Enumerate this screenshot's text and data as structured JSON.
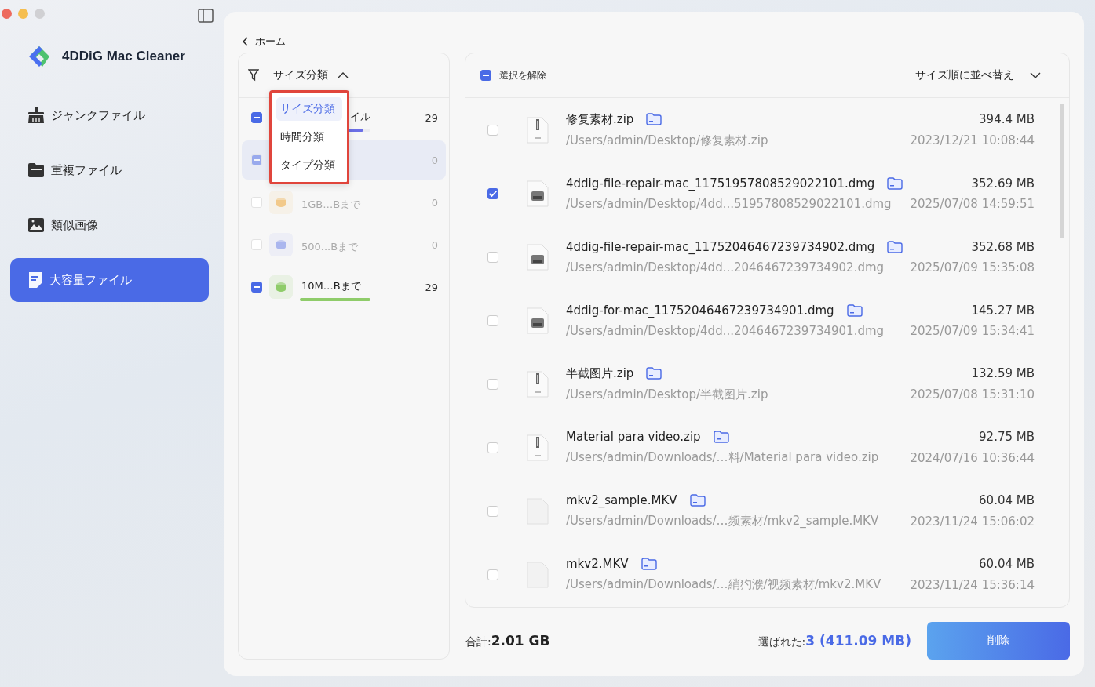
{
  "app": {
    "name": "4DDiG Mac Cleaner"
  },
  "sidebar": {
    "items": [
      {
        "label": "ジャンクファイル",
        "kind": "broom",
        "selected": false
      },
      {
        "label": "重複ファイル",
        "kind": "folder",
        "selected": false
      },
      {
        "label": "類似画像",
        "kind": "image",
        "selected": false
      },
      {
        "label": "大容量ファイル",
        "kind": "note",
        "selected": true
      }
    ]
  },
  "back": {
    "label": "ホーム"
  },
  "filter": {
    "label": "サイズ分類",
    "expanded": true,
    "options": [
      {
        "label": "サイズ分類",
        "selected": true
      },
      {
        "label": "時間分類",
        "selected": false
      },
      {
        "label": "タイプ分類",
        "selected": false
      }
    ]
  },
  "categories": [
    {
      "label": "イル",
      "count": "29",
      "partial": true,
      "disabled": false,
      "selected": false,
      "level": 0.9,
      "color": "#6b6fe6"
    },
    {
      "count": "0",
      "partial": true,
      "disabled": true,
      "selected": true
    },
    {
      "label": "1GB…Bまで",
      "count": "0",
      "partial": false,
      "disabled": true,
      "selected": false,
      "color": "#f2c98a"
    },
    {
      "label": "500...Bまで",
      "count": "0",
      "partial": false,
      "disabled": true,
      "selected": false,
      "color": "#aab6ee"
    },
    {
      "label": "10M…Bまで",
      "count": "29",
      "partial": true,
      "disabled": false,
      "selected": false,
      "level": 1.0,
      "color": "#8fcc6a"
    }
  ],
  "list": {
    "deselect_label": "選択を解除",
    "sort_label": "サイズ順に並べ替え"
  },
  "files": [
    {
      "kind": "zip",
      "name": "修复素材.zip",
      "path": "/Users/admin/Desktop/修复素材.zip",
      "size": "394.4  MB",
      "date": "2023/12/21 10:08:44",
      "checked": false
    },
    {
      "kind": "dmg",
      "name": "4ddig-file-repair-mac_11751957808529022101.dmg",
      "path": "/Users/admin/Desktop/4dd...51957808529022101.dmg",
      "size": "352.69  MB",
      "date": "2025/07/08 14:59:51",
      "checked": true
    },
    {
      "kind": "dmg",
      "name": "4ddig-file-repair-mac_11752046467239734902.dmg",
      "path": "/Users/admin/Desktop/4dd...2046467239734902.dmg",
      "size": "352.68  MB",
      "date": "2025/07/09 15:35:08",
      "checked": false
    },
    {
      "kind": "dmg",
      "name": "4ddig-for-mac_11752046467239734901.dmg",
      "path": "/Users/admin/Desktop/4dd...2046467239734901.dmg",
      "size": "145.27  MB",
      "date": "2025/07/09 15:34:41",
      "checked": false
    },
    {
      "kind": "zip",
      "name": "半截图片.zip",
      "path": "/Users/admin/Desktop/半截图片.zip",
      "size": "132.59  MB",
      "date": "2025/07/08 15:31:10",
      "checked": false
    },
    {
      "kind": "zip",
      "name": "Material para video.zip",
      "path": "/Users/admin/Downloads/…料/Material para video.zip",
      "size": "92.75  MB",
      "date": "2024/07/16 10:36:44",
      "checked": false
    },
    {
      "kind": "file",
      "name": "mkv2_sample.MKV",
      "path": "/Users/admin/Downloads/…频素材/mkv2_sample.MKV",
      "size": "60.04  MB",
      "date": "2023/11/24 15:06:02",
      "checked": false
    },
    {
      "kind": "file",
      "name": "mkv2.MKV",
      "path": "/Users/admin/Downloads/…綃犳濮/视频素材/mkv2.MKV",
      "size": "60.04  MB",
      "date": "2023/11/24 15:36:14",
      "checked": false
    }
  ],
  "footer": {
    "total_label": "合計:",
    "total": "2.01 GB",
    "selected_label": "選ばれた:",
    "selected": "3 (411.09  MB)",
    "delete_button": "削除"
  }
}
